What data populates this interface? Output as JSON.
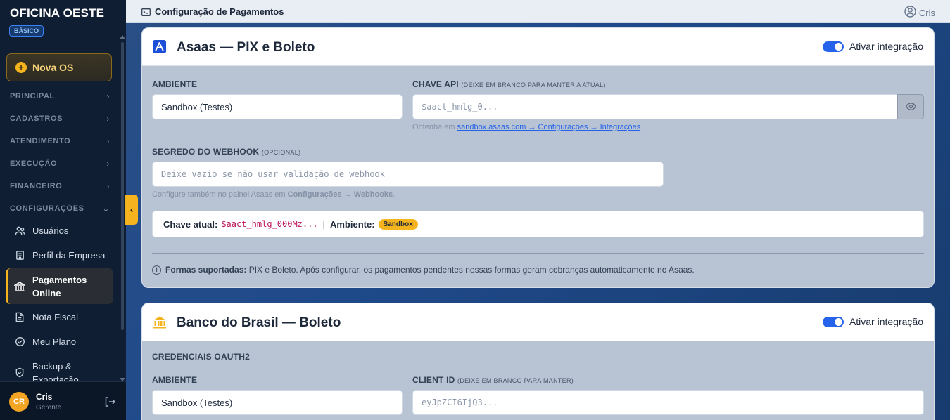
{
  "sidebar": {
    "brand": "OFICINA OESTE",
    "plan": "BÁSICO",
    "new_os": "Nova OS",
    "sections": [
      "PRINCIPAL",
      "CADASTROS",
      "ATENDIMENTO",
      "EXECUÇÃO",
      "FINANCEIRO",
      "CONFIGURAÇÕES"
    ],
    "items": [
      "Usuários",
      "Perfil da Empresa",
      "Pagamentos Online",
      "Nota Fiscal",
      "Meu Plano",
      "Backup & Exportação"
    ],
    "user": {
      "initials": "CR",
      "name": "Cris",
      "role": "Gerente"
    }
  },
  "topbar": {
    "title": "Configuração de Pagamentos",
    "user": "Cris"
  },
  "asaas": {
    "title": "Asaas — PIX e Boleto",
    "toggle_label": "Ativar integração",
    "ambiente_label": "AMBIENTE",
    "ambiente_value": "Sandbox (Testes)",
    "api_label": "CHAVE API",
    "api_sub": "(DEIXE EM BRANCO PARA MANTER A ATUAL)",
    "api_placeholder": "$aact_hmlg_0...",
    "help_prefix": "Obtenha em",
    "help_link": "sandbox.asaas.com → Configurações → Integrações",
    "webhook_label": "SEGREDO DO WEBHOOK",
    "webhook_sub": "(OPCIONAL)",
    "webhook_placeholder": "Deixe vazio se não usar validação de webhook",
    "webhook_help_prefix": "Configure também no painel Asaas em",
    "webhook_help_bold": "Configurações → Webhooks",
    "webhook_help_suffix": ".",
    "current_key_label": "Chave atual:",
    "current_key_value": "$aact_hmlg_000Mz...",
    "separator": "|",
    "current_env_label": "Ambiente:",
    "current_env_value": "Sandbox",
    "note_bold": "Formas suportadas:",
    "note_text": "PIX e Boleto. Após configurar, os pagamentos pendentes nessas formas geram cobranças automaticamente no Asaas."
  },
  "bb": {
    "title": "Banco do Brasil — Boleto",
    "toggle_label": "Ativar integração",
    "oauth_label": "CREDENCIAIS OAUTH2",
    "ambiente_label": "AMBIENTE",
    "ambiente_value": "Sandbox (Testes)",
    "client_label": "CLIENT ID",
    "client_sub": "(DEIXE EM BRANCO PARA MANTER)",
    "client_placeholder": "eyJpZCI6IjQ3..."
  }
}
